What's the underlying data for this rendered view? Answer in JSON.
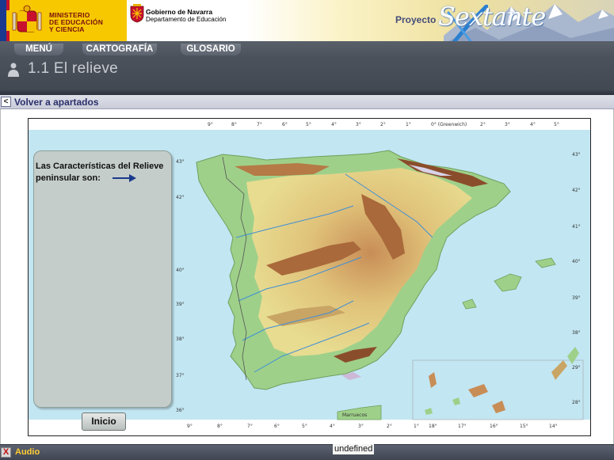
{
  "header": {
    "ministry_line1": "MINISTERIO",
    "ministry_line2": "DE EDUCACIÓN",
    "ministry_line3": "Y CIENCIA",
    "navarra_title": "Gobierno de Navarra",
    "navarra_subtitle": "Departamento de Educación",
    "proyecto_label": "Proyecto",
    "logo_text": "Sextante"
  },
  "nav": {
    "tabs": [
      {
        "label": "MENÚ"
      },
      {
        "label": "CARTOGRAFÍA"
      },
      {
        "label": "GLOSARIO"
      }
    ],
    "page_title": "1.1 El relieve"
  },
  "backbar": {
    "arrow": "<",
    "label": "Volver a apartados"
  },
  "panel": {
    "text": "Las Características del Relieve peninsular son:",
    "button_label": "Inicio"
  },
  "map": {
    "top_labels": [
      "9°",
      "8°",
      "7°",
      "6°",
      "5°",
      "4°",
      "3°",
      "2°",
      "1°",
      "0° (Greenwich)",
      "2°",
      "3°",
      "4°",
      "5°"
    ],
    "bottom_labels": [
      "9°",
      "8°",
      "7°",
      "6°",
      "5°",
      "4°",
      "3°",
      "2°",
      "1°",
      "18°",
      "17°",
      "16°",
      "15°",
      "14°"
    ],
    "left_labels": [
      "43°",
      "42°",
      "40°",
      "39°",
      "38°",
      "37°",
      "36°"
    ],
    "right_labels": [
      "43°",
      "42°",
      "41°",
      "40°",
      "39°",
      "38°",
      "29°",
      "28°"
    ],
    "marruecos_label": "Marruecos",
    "colors": {
      "sea": "#c2e6f2",
      "lowland": "#9fd08a",
      "mid": "#e7dc90",
      "high": "#c88d56",
      "peak": "#8a4d2b"
    }
  },
  "footer": {
    "close_icon": "X",
    "audio_label": "Audio",
    "status": "undefined"
  }
}
